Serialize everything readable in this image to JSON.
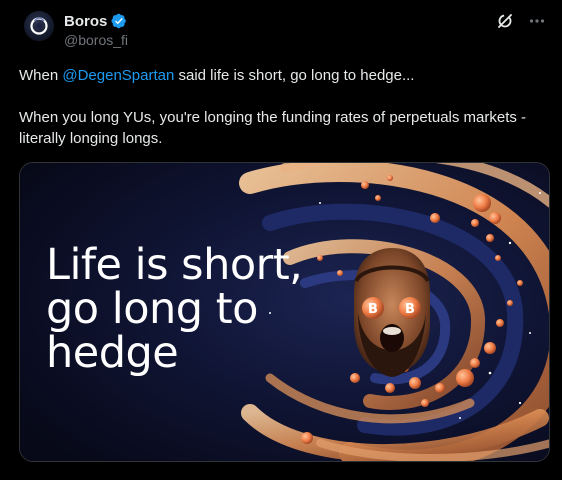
{
  "author": {
    "display_name": "Boros",
    "handle": "@boros_fi",
    "verified": true,
    "avatar_icon": "boros-logo-icon"
  },
  "actions": {
    "grok_icon": "grok-icon",
    "more_icon": "more-icon"
  },
  "tweet": {
    "line1_prefix": "When ",
    "mention": "@DegenSpartan",
    "line1_suffix": " said life is short, go long to hedge...",
    "line2": "When you long YUs, you're longing the funding rates of perpetuals markets - literally longing longs."
  },
  "media": {
    "headline_lines": [
      "Life is short,",
      "go long to",
      "hedge"
    ]
  },
  "colors": {
    "background": "#000000",
    "text": "#e7e9ea",
    "secondary": "#71767b",
    "accent": "#1d9bf0",
    "orb": "#f08a4b"
  }
}
